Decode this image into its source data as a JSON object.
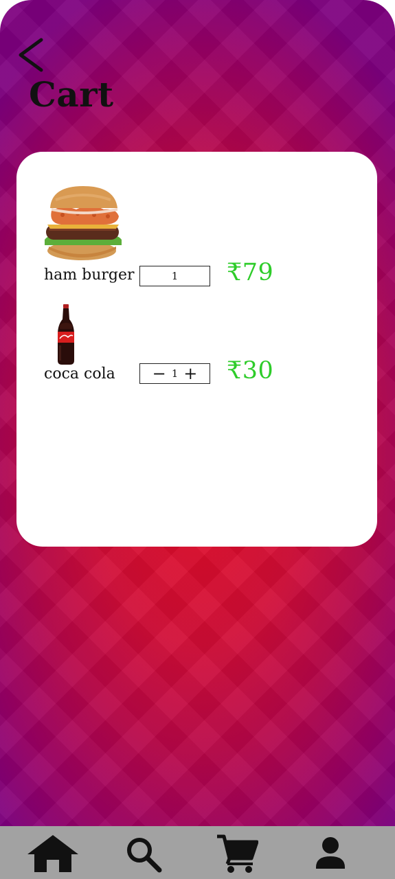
{
  "header": {
    "title": "Cart",
    "back_icon": "chevron-left-icon"
  },
  "colors": {
    "price": "#2ecc2a",
    "background_center": "#e50b22",
    "background_edge": "#7e007f",
    "nav_background": "#a2a2a2",
    "card": "#ffffff"
  },
  "cart": {
    "items": [
      {
        "name": "ham burger",
        "quantity": "1",
        "price": "₹79",
        "image": "burger-image",
        "stepper_visible": false
      },
      {
        "name": "coca cola",
        "quantity": "1",
        "price": "₹30",
        "image": "cola-bottle-image",
        "stepper_visible": true,
        "decrement_symbol": "−",
        "increment_symbol": "+"
      }
    ]
  },
  "nav": {
    "items": [
      {
        "icon": "home-icon"
      },
      {
        "icon": "search-icon"
      },
      {
        "icon": "cart-icon"
      },
      {
        "icon": "profile-icon"
      }
    ]
  }
}
